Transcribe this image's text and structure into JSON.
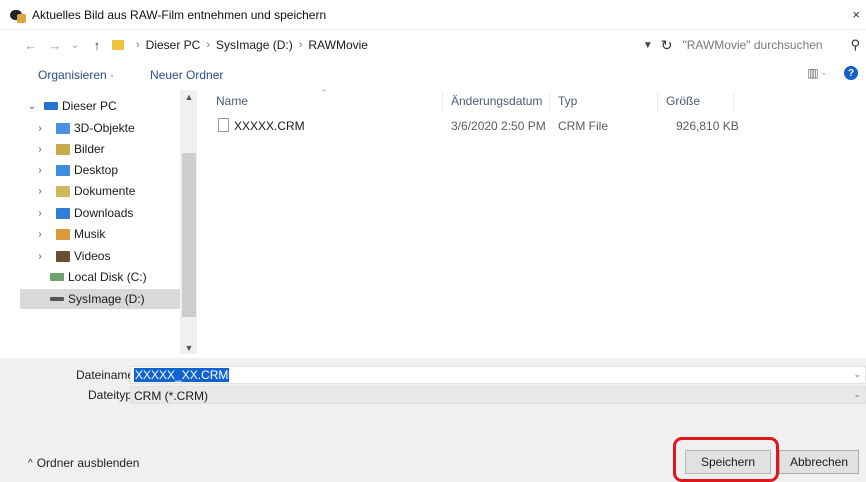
{
  "window": {
    "title": "Aktuelles Bild aus RAW-Film entnehmen und speichern",
    "close_glyph": "×"
  },
  "addressbar": {
    "back_glyph": "←",
    "forward_glyph": "→",
    "recent_glyph": "⌄",
    "up_glyph": "↑",
    "breadcrumbs": [
      "Dieser PC",
      "SysImage (D:)",
      "RAWMovie"
    ],
    "separator": "›",
    "search_placeholder": "\"RAWMovie\" durchsuchen"
  },
  "toolbar": {
    "organize": "Organisieren ·",
    "new_folder": "Neuer Ordner",
    "help": "?"
  },
  "navpane": {
    "items": [
      {
        "label": "Dieser PC",
        "color": "#2a72cf"
      },
      {
        "label": "3D-Objekte",
        "color": "#4a8fe0"
      },
      {
        "label": "Bilder",
        "color": "#c9a94a"
      },
      {
        "label": "Desktop",
        "color": "#3e8de0"
      },
      {
        "label": "Dokumente",
        "color": "#d2b65e"
      },
      {
        "label": "Downloads",
        "color": "#2f7fd6"
      },
      {
        "label": "Musik",
        "color": "#d99a3a"
      },
      {
        "label": "Videos",
        "color": "#6a4f2f"
      },
      {
        "label": "Local Disk (C:)",
        "color": "#6ea36a"
      },
      {
        "label": "SysImage (D:)",
        "color": "#555555"
      }
    ]
  },
  "filelist": {
    "columns": [
      "Name",
      "Änderungsdatum",
      "Typ",
      "Größe"
    ],
    "rows": [
      {
        "name": "XXXXX.CRM",
        "date": "3/6/2020 2:50 PM",
        "type": "CRM File",
        "size": "926,810 KB"
      }
    ]
  },
  "form": {
    "filename_label": "Dateiname:",
    "filename_value": "XXXXX_XX.CRM",
    "filetype_label": "Dateityp:",
    "filetype_value": "CRM (*.CRM)"
  },
  "footer": {
    "hide_folders": "Ordner ausblenden",
    "save": "Speichern",
    "cancel": "Abbrechen"
  },
  "colors": {
    "link": "#2a4f8a",
    "selection": "#0f64d2",
    "highlight": "#e0161b"
  }
}
